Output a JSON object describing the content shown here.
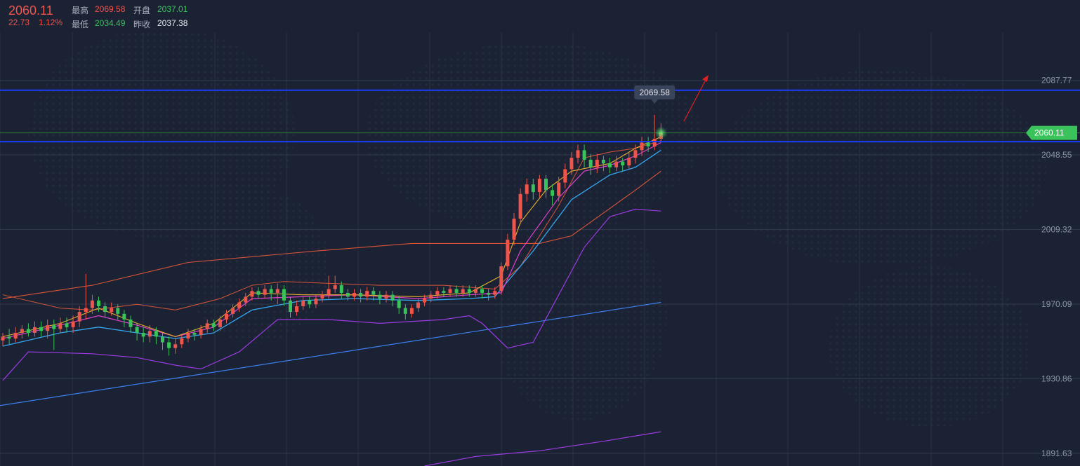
{
  "header": {
    "last_price": "2060.11",
    "change": "22.73",
    "change_pct": "1.12%",
    "high_label": "最高",
    "high_value": "2069.58",
    "open_label": "开盘",
    "open_value": "2037.01",
    "low_label": "最低",
    "low_value": "2034.49",
    "prev_close_label": "昨收",
    "prev_close_value": "2037.38"
  },
  "colors": {
    "background": "#1b2233",
    "up": "#f0554b",
    "down": "#39c35a",
    "support_resistance": "#1a3cff",
    "trend_line": "#3d7ff0",
    "bollinger": "#9b3be0",
    "ma_long": "#d8553a",
    "ma_mid": "#35a6f0",
    "ma_short": "#e8b030",
    "ma_fast": "#e040d0",
    "arrow": "#e02020"
  },
  "chart_data": {
    "type": "candlestick",
    "y_ticks": [
      "2087.77",
      "2048.55",
      "2009.32",
      "1970.09",
      "1930.86",
      "1891.63"
    ],
    "ylim": [
      1885,
      2113
    ],
    "current_price": "2060.11",
    "max_price_label": "2069.58",
    "horizontal_levels": [
      2082.5,
      2055.5
    ],
    "grid": true,
    "candles_approx": [
      [
        1,
        1951,
        1953,
        1955,
        1948
      ],
      [
        2,
        1953,
        1952,
        1957,
        1949
      ],
      [
        3,
        1952,
        1955,
        1958,
        1950
      ],
      [
        4,
        1955,
        1957,
        1959,
        1952
      ],
      [
        5,
        1957,
        1955,
        1960,
        1953
      ],
      [
        6,
        1955,
        1958,
        1961,
        1953
      ],
      [
        7,
        1958,
        1956,
        1961,
        1953
      ],
      [
        8,
        1956,
        1959,
        1962,
        1952
      ],
      [
        9,
        1959,
        1957,
        1962,
        1946
      ],
      [
        10,
        1957,
        1960,
        1963,
        1955
      ],
      [
        11,
        1960,
        1958,
        1963,
        1955
      ],
      [
        12,
        1958,
        1961,
        1964,
        1955
      ],
      [
        13,
        1961,
        1966,
        1969,
        1958
      ],
      [
        14,
        1966,
        1968,
        1986,
        1962
      ],
      [
        15,
        1968,
        1972,
        1975,
        1965
      ],
      [
        16,
        1972,
        1969,
        1974,
        1966
      ],
      [
        17,
        1969,
        1966,
        1971,
        1963
      ],
      [
        18,
        1966,
        1968,
        1971,
        1964
      ],
      [
        19,
        1968,
        1965,
        1970,
        1962
      ],
      [
        20,
        1965,
        1962,
        1967,
        1958
      ],
      [
        21,
        1962,
        1958,
        1964,
        1955
      ],
      [
        22,
        1958,
        1955,
        1960,
        1951
      ],
      [
        23,
        1955,
        1953,
        1958,
        1950
      ],
      [
        24,
        1953,
        1956,
        1959,
        1950
      ],
      [
        25,
        1956,
        1953,
        1958,
        1949
      ],
      [
        26,
        1953,
        1950,
        1955,
        1946
      ],
      [
        27,
        1950,
        1947,
        1953,
        1943
      ],
      [
        28,
        1947,
        1949,
        1952,
        1944
      ],
      [
        29,
        1949,
        1952,
        1954,
        1947
      ],
      [
        30,
        1952,
        1955,
        1957,
        1950
      ],
      [
        31,
        1955,
        1954,
        1957,
        1951
      ],
      [
        32,
        1954,
        1957,
        1959,
        1952
      ],
      [
        33,
        1957,
        1960,
        1962,
        1955
      ],
      [
        34,
        1960,
        1958,
        1962,
        1956
      ],
      [
        35,
        1958,
        1962,
        1964,
        1956
      ],
      [
        36,
        1962,
        1965,
        1967,
        1960
      ],
      [
        37,
        1965,
        1968,
        1970,
        1963
      ],
      [
        38,
        1968,
        1971,
        1973,
        1966
      ],
      [
        39,
        1971,
        1974,
        1976,
        1969
      ],
      [
        40,
        1974,
        1977,
        1979,
        1972
      ],
      [
        41,
        1977,
        1975,
        1979,
        1973
      ],
      [
        42,
        1975,
        1978,
        1980,
        1973
      ],
      [
        43,
        1978,
        1976,
        1980,
        1972
      ],
      [
        44,
        1976,
        1978,
        1981,
        1970
      ],
      [
        45,
        1978,
        1972,
        1980,
        1969
      ],
      [
        46,
        1972,
        1966,
        1974,
        1963
      ],
      [
        47,
        1966,
        1969,
        1972,
        1964
      ],
      [
        48,
        1969,
        1972,
        1974,
        1967
      ],
      [
        49,
        1972,
        1970,
        1974,
        1968
      ],
      [
        50,
        1970,
        1973,
        1975,
        1968
      ],
      [
        51,
        1973,
        1975,
        1977,
        1971
      ],
      [
        52,
        1975,
        1978,
        1985,
        1973
      ],
      [
        53,
        1978,
        1980,
        1985,
        1976
      ],
      [
        54,
        1980,
        1976,
        1982,
        1973
      ],
      [
        55,
        1976,
        1974,
        1978,
        1972
      ],
      [
        56,
        1974,
        1976,
        1978,
        1972
      ],
      [
        57,
        1976,
        1974,
        1978,
        1971
      ],
      [
        58,
        1974,
        1977,
        1979,
        1972
      ],
      [
        59,
        1977,
        1975,
        1979,
        1972
      ],
      [
        60,
        1975,
        1973,
        1977,
        1970
      ],
      [
        61,
        1973,
        1975,
        1977,
        1971
      ],
      [
        62,
        1975,
        1972,
        1977,
        1969
      ],
      [
        63,
        1972,
        1968,
        1974,
        1965
      ],
      [
        64,
        1968,
        1965,
        1970,
        1962
      ],
      [
        65,
        1965,
        1968,
        1970,
        1963
      ],
      [
        66,
        1968,
        1971,
        1973,
        1966
      ],
      [
        67,
        1971,
        1973,
        1975,
        1969
      ],
      [
        68,
        1973,
        1975,
        1977,
        1971
      ],
      [
        69,
        1975,
        1977,
        1979,
        1973
      ],
      [
        70,
        1977,
        1976,
        1979,
        1974
      ],
      [
        71,
        1976,
        1978,
        1980,
        1974
      ],
      [
        72,
        1978,
        1976,
        1980,
        1974
      ],
      [
        73,
        1976,
        1978,
        1980,
        1974
      ],
      [
        74,
        1978,
        1976,
        1980,
        1974
      ],
      [
        75,
        1976,
        1978,
        1980,
        1974
      ],
      [
        76,
        1978,
        1976,
        1980,
        1973
      ],
      [
        77,
        1976,
        1975,
        1978,
        1972
      ],
      [
        78,
        1975,
        1977,
        1979,
        1973
      ],
      [
        79,
        1977,
        1990,
        1992,
        1975
      ],
      [
        80,
        1990,
        2004,
        2007,
        1988
      ],
      [
        81,
        2004,
        2015,
        2018,
        2001
      ],
      [
        82,
        2015,
        2028,
        2031,
        2012
      ],
      [
        83,
        2028,
        2033,
        2036,
        2024
      ],
      [
        84,
        2033,
        2029,
        2036,
        2025
      ],
      [
        85,
        2029,
        2036,
        2038,
        2026
      ],
      [
        86,
        2036,
        2030,
        2038,
        2026
      ],
      [
        87,
        2030,
        2027,
        2033,
        2022
      ],
      [
        88,
        2027,
        2034,
        2037,
        2024
      ],
      [
        89,
        2034,
        2041,
        2044,
        2031
      ],
      [
        90,
        2041,
        2047,
        2050,
        2038
      ],
      [
        91,
        2047,
        2051,
        2054,
        2044
      ],
      [
        92,
        2051,
        2046,
        2054,
        2042
      ],
      [
        93,
        2046,
        2042,
        2049,
        2038
      ],
      [
        94,
        2042,
        2046,
        2049,
        2039
      ],
      [
        95,
        2046,
        2044,
        2048,
        2040
      ],
      [
        96,
        2044,
        2042,
        2047,
        2039
      ],
      [
        97,
        2042,
        2045,
        2048,
        2040
      ],
      [
        98,
        2045,
        2043,
        2047,
        2040
      ],
      [
        99,
        2043,
        2047,
        2050,
        2041
      ],
      [
        100,
        2047,
        2051,
        2054,
        2044
      ],
      [
        101,
        2051,
        2055,
        2058,
        2048
      ],
      [
        102,
        2055,
        2053,
        2058,
        2050
      ],
      [
        103,
        2053,
        2057,
        2069.58,
        2051
      ],
      [
        104,
        2057,
        2060.11,
        2065,
        2055
      ]
    ],
    "overlays": [
      "MA short",
      "MA fast",
      "MA mid",
      "MA long",
      "Bollinger bands",
      "Trend line"
    ]
  }
}
